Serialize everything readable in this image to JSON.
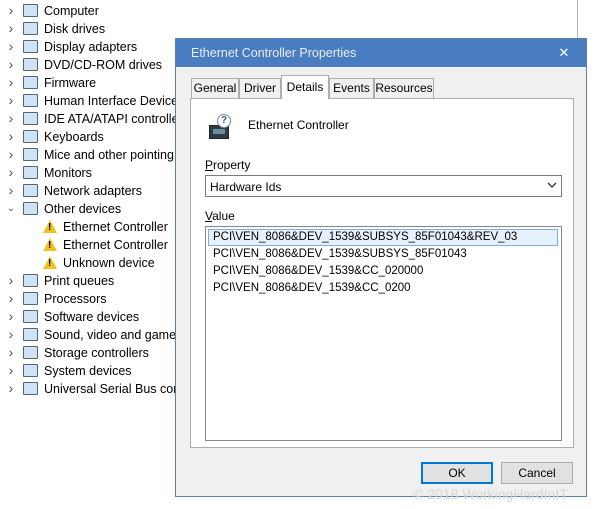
{
  "tree": {
    "items": [
      {
        "label": "Computer",
        "icon": "computer-icon",
        "expanded": false,
        "child": false
      },
      {
        "label": "Disk drives",
        "icon": "disk-drive-icon",
        "expanded": false,
        "child": false
      },
      {
        "label": "Display adapters",
        "icon": "display-adapter-icon",
        "expanded": false,
        "child": false
      },
      {
        "label": "DVD/CD-ROM drives",
        "icon": "dvd-drive-icon",
        "expanded": false,
        "child": false
      },
      {
        "label": "Firmware",
        "icon": "firmware-icon",
        "expanded": false,
        "child": false
      },
      {
        "label": "Human Interface Devices",
        "icon": "hid-icon",
        "expanded": false,
        "child": false
      },
      {
        "label": "IDE ATA/ATAPI controllers",
        "icon": "ide-controller-icon",
        "expanded": false,
        "child": false
      },
      {
        "label": "Keyboards",
        "icon": "keyboard-icon",
        "expanded": false,
        "child": false
      },
      {
        "label": "Mice and other pointing devices",
        "icon": "mouse-icon",
        "expanded": false,
        "child": false
      },
      {
        "label": "Monitors",
        "icon": "monitor-icon",
        "expanded": false,
        "child": false
      },
      {
        "label": "Network adapters",
        "icon": "network-adapter-icon",
        "expanded": false,
        "child": false
      },
      {
        "label": "Other devices",
        "icon": "other-devices-icon",
        "expanded": true,
        "child": false
      },
      {
        "label": "Ethernet Controller",
        "icon": "warning-icon",
        "child": true
      },
      {
        "label": "Ethernet Controller",
        "icon": "warning-icon",
        "child": true
      },
      {
        "label": "Unknown device",
        "icon": "warning-icon",
        "child": true
      },
      {
        "label": "Print queues",
        "icon": "print-queue-icon",
        "expanded": false,
        "child": false
      },
      {
        "label": "Processors",
        "icon": "processor-icon",
        "expanded": false,
        "child": false
      },
      {
        "label": "Software devices",
        "icon": "software-device-icon",
        "expanded": false,
        "child": false
      },
      {
        "label": "Sound, video and game controllers",
        "icon": "sound-icon",
        "expanded": false,
        "child": false
      },
      {
        "label": "Storage controllers",
        "icon": "storage-controller-icon",
        "expanded": false,
        "child": false
      },
      {
        "label": "System devices",
        "icon": "system-device-icon",
        "expanded": false,
        "child": false
      },
      {
        "label": "Universal Serial Bus controllers",
        "icon": "usb-icon",
        "expanded": false,
        "child": false
      }
    ]
  },
  "dialog": {
    "title": "Ethernet Controller Properties",
    "close_glyph": "✕",
    "tabs": [
      {
        "label": "General",
        "active": false
      },
      {
        "label": "Driver",
        "active": false
      },
      {
        "label": "Details",
        "active": true
      },
      {
        "label": "Events",
        "active": false
      },
      {
        "label": "Resources",
        "active": false
      }
    ],
    "device_name": "Ethernet Controller",
    "property_label": "Property",
    "property_value": "Hardware Ids",
    "value_label": "Value",
    "values": [
      "PCI\\VEN_8086&DEV_1539&SUBSYS_85F01043&REV_03",
      "PCI\\VEN_8086&DEV_1539&SUBSYS_85F01043",
      "PCI\\VEN_8086&DEV_1539&CC_020000",
      "PCI\\VEN_8086&DEV_1539&CC_0200"
    ],
    "selected_value_index": 0,
    "ok_label": "OK",
    "cancel_label": "Cancel"
  },
  "watermark": "© 2018 WorkingHardInIT",
  "colors": {
    "titlebar": "#4a7cc1",
    "selection": "#e5f1fb",
    "warning": "#f1c21b"
  }
}
